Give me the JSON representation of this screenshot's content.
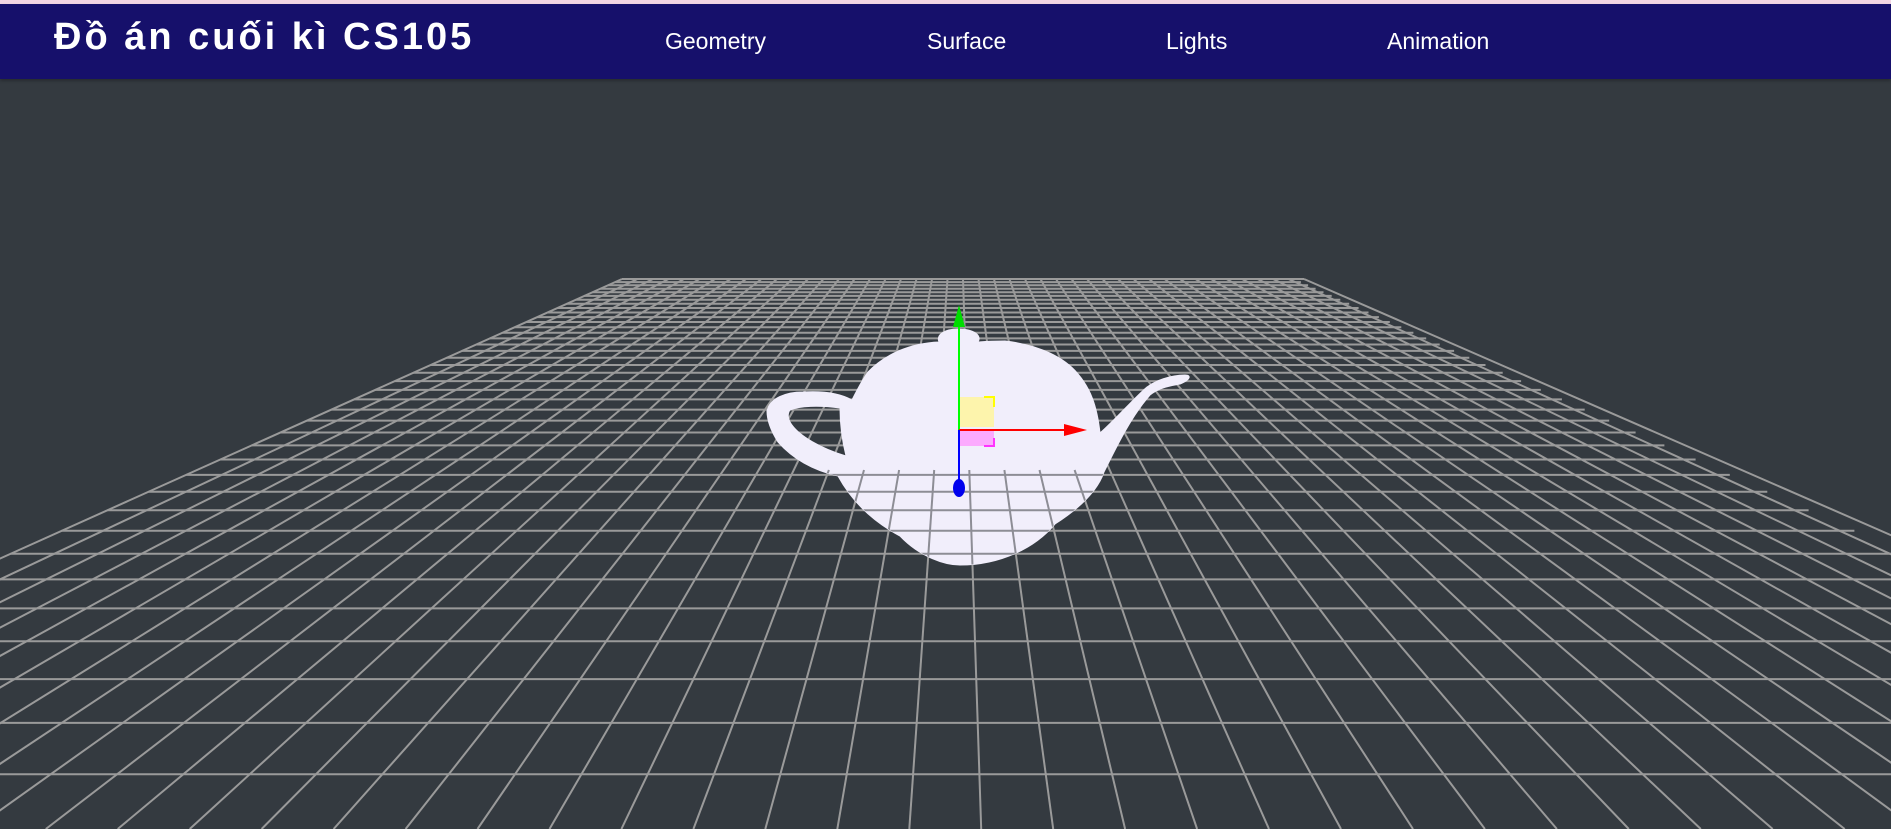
{
  "header": {
    "title": "Đồ án cuối kì CS105"
  },
  "nav": {
    "items": [
      {
        "label": "Geometry"
      },
      {
        "label": "Surface"
      },
      {
        "label": "Lights"
      },
      {
        "label": "Animation"
      }
    ]
  },
  "scene": {
    "background_color": "#343a40",
    "grid_color": "#9a9a9a",
    "object": "teapot",
    "object_color": "#f1eefb",
    "gizmo": {
      "x_axis_color": "#ff0000",
      "y_axis_color": "#00ff00",
      "z_axis_color": "#0000ff",
      "xy_plane_color": "#fff59d",
      "xz_plane_color": "#ff99ff"
    }
  }
}
